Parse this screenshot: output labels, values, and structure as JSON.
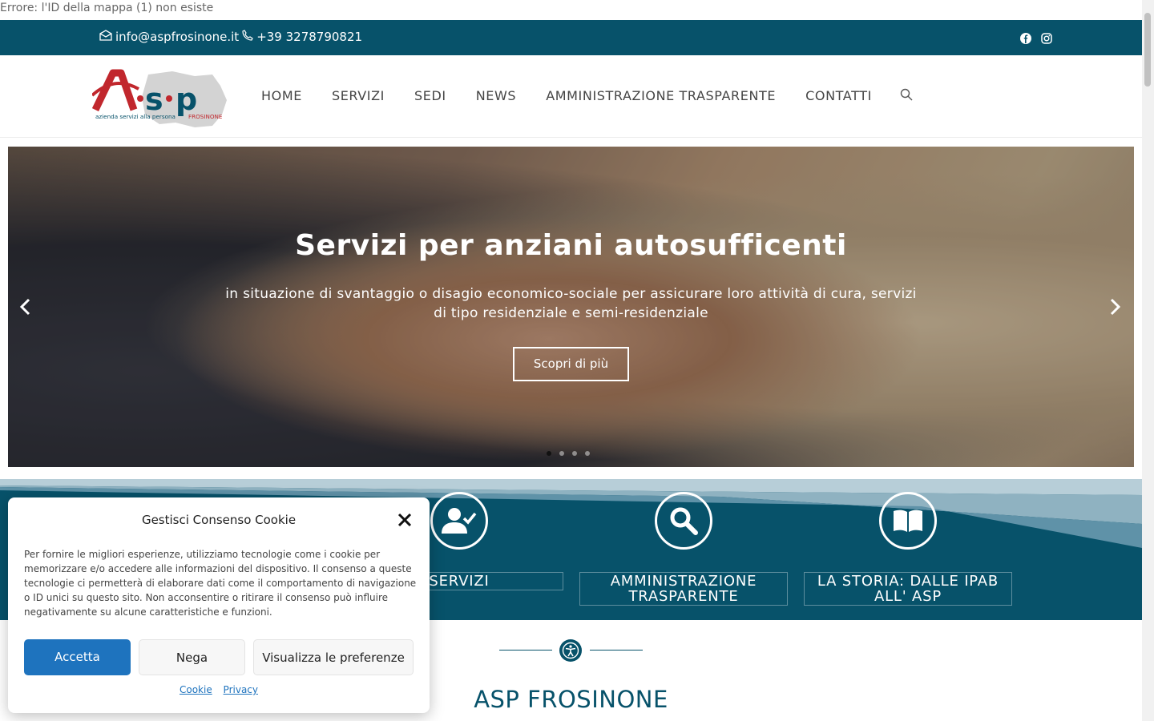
{
  "error_text": "Errore: l'ID della mappa (1) non esiste",
  "topbar": {
    "email": "info@aspfrosinone.it",
    "phone": "+39 3278790821"
  },
  "logo": {
    "main": "A·s·p",
    "tagline": "azienda servizi alla persona",
    "city": "FROSINONE"
  },
  "nav": [
    "HOME",
    "SERVIZI",
    "SEDI",
    "NEWS",
    "AMMINISTRAZIONE TRASPARENTE",
    "CONTATTI"
  ],
  "hero": {
    "title": "Servizi per anziani autosufficenti",
    "text": "in situazione di svantaggio o disagio economico-sociale per assicurare loro attività di cura, servizi di tipo residenziale e semi-residenziale",
    "button": "Scopri di più"
  },
  "features": [
    "SERVIZI",
    "AMMINISTRAZIONE TRASPARENTE",
    "LA STORIA: DALLE IPAB ALL' ASP"
  ],
  "section_title": "ASP FROSINONE",
  "cookie": {
    "title": "Gestisci Consenso Cookie",
    "text": "Per fornire le migliori esperienze, utilizziamo tecnologie come i cookie per memorizzare e/o accedere alle informazioni del dispositivo. Il consenso a queste tecnologie ci permetterà di elaborare dati come il comportamento di navigazione o ID unici su questo sito. Non acconsentire o ritirare il consenso può influire negativamente su alcune caratteristiche e funzioni.",
    "accept": "Accetta",
    "deny": "Nega",
    "prefs": "Visualizza le preferenze",
    "link_cookie": "Cookie",
    "link_privacy": "Privacy"
  }
}
